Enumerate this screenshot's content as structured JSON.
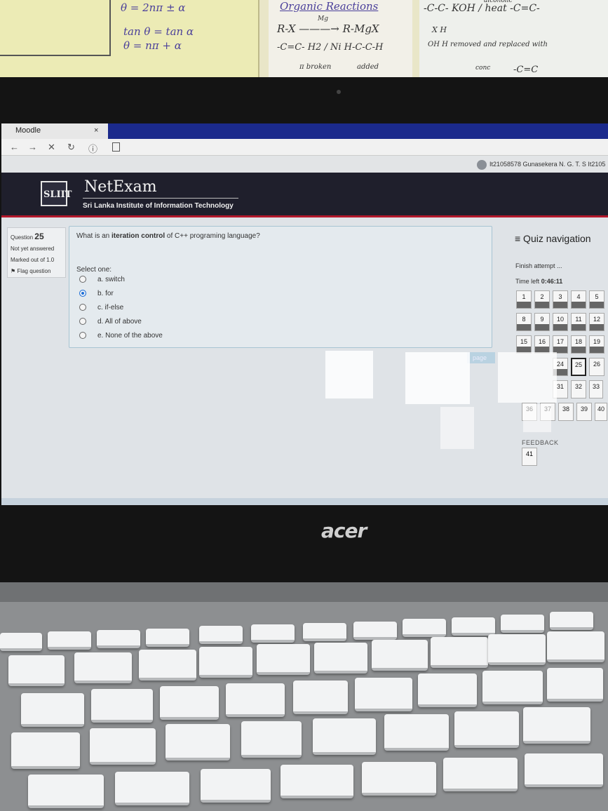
{
  "notes": {
    "left_lines": [
      "θ = 2nπ ± α",
      "tan θ = tan α",
      "θ = nπ + α"
    ],
    "mid_title": "Organic Reactions",
    "mid_lines": [
      "Mg",
      "R-X  ———→  R-MgX",
      "-C=C- H2 / Ni  H-C-C-H",
      "π broken",
      "added"
    ],
    "right_lines": [
      "alcoholic",
      "-C-C-  KOH / heat  -C=C-",
      "X  H",
      "OH  H removed and replaced with",
      "conc",
      "-C=C"
    ]
  },
  "browser": {
    "tab_title": "Moodle",
    "tab_close": "×",
    "back": "←",
    "forward": "→",
    "stop": "✕",
    "reload": "↻",
    "info": "ⓘ",
    "user_name": "It21058578 Gunasekera N. G. T. S It2105"
  },
  "header": {
    "logo_text": "SLIIT",
    "brand": "NetExam",
    "institute": "Sri Lanka Institute of Information Technology"
  },
  "question_info": {
    "label": "Question",
    "number": "25",
    "status": "Not yet answered",
    "marks": "Marked out of 1.0",
    "flag": "Flag question"
  },
  "question": {
    "text_before": "What is an ",
    "text_bold": "iteration control",
    "text_after": " of C++ programing language?",
    "select_label": "Select one:",
    "options": [
      {
        "label": "a. switch",
        "selected": false
      },
      {
        "label": "b. for",
        "selected": true
      },
      {
        "label": "c. if-else",
        "selected": false
      },
      {
        "label": "d. All of above",
        "selected": false
      },
      {
        "label": "e. None of the above",
        "selected": false
      }
    ]
  },
  "next_page": "page",
  "quiz_nav": {
    "title": "≡ Quiz navigation",
    "finish": "Finish attempt ...",
    "time_label": "Time left ",
    "time_value": "0:46:11",
    "buttons": [
      "1",
      "2",
      "3",
      "4",
      "5",
      "8",
      "9",
      "10",
      "11",
      "12",
      "15",
      "16",
      "17",
      "18",
      "19",
      "24",
      "25",
      "26",
      "31",
      "32",
      "33",
      "36",
      "37",
      "38",
      "39",
      "40"
    ],
    "current": "25",
    "feedback_label": "FEEDBACK",
    "feedback_button": "41"
  },
  "brand_laptop": "acer",
  "colors": {
    "accent_red": "#b3182c",
    "tab_blue": "#1b2a8c",
    "radio_selected": "#1d6fd8"
  }
}
